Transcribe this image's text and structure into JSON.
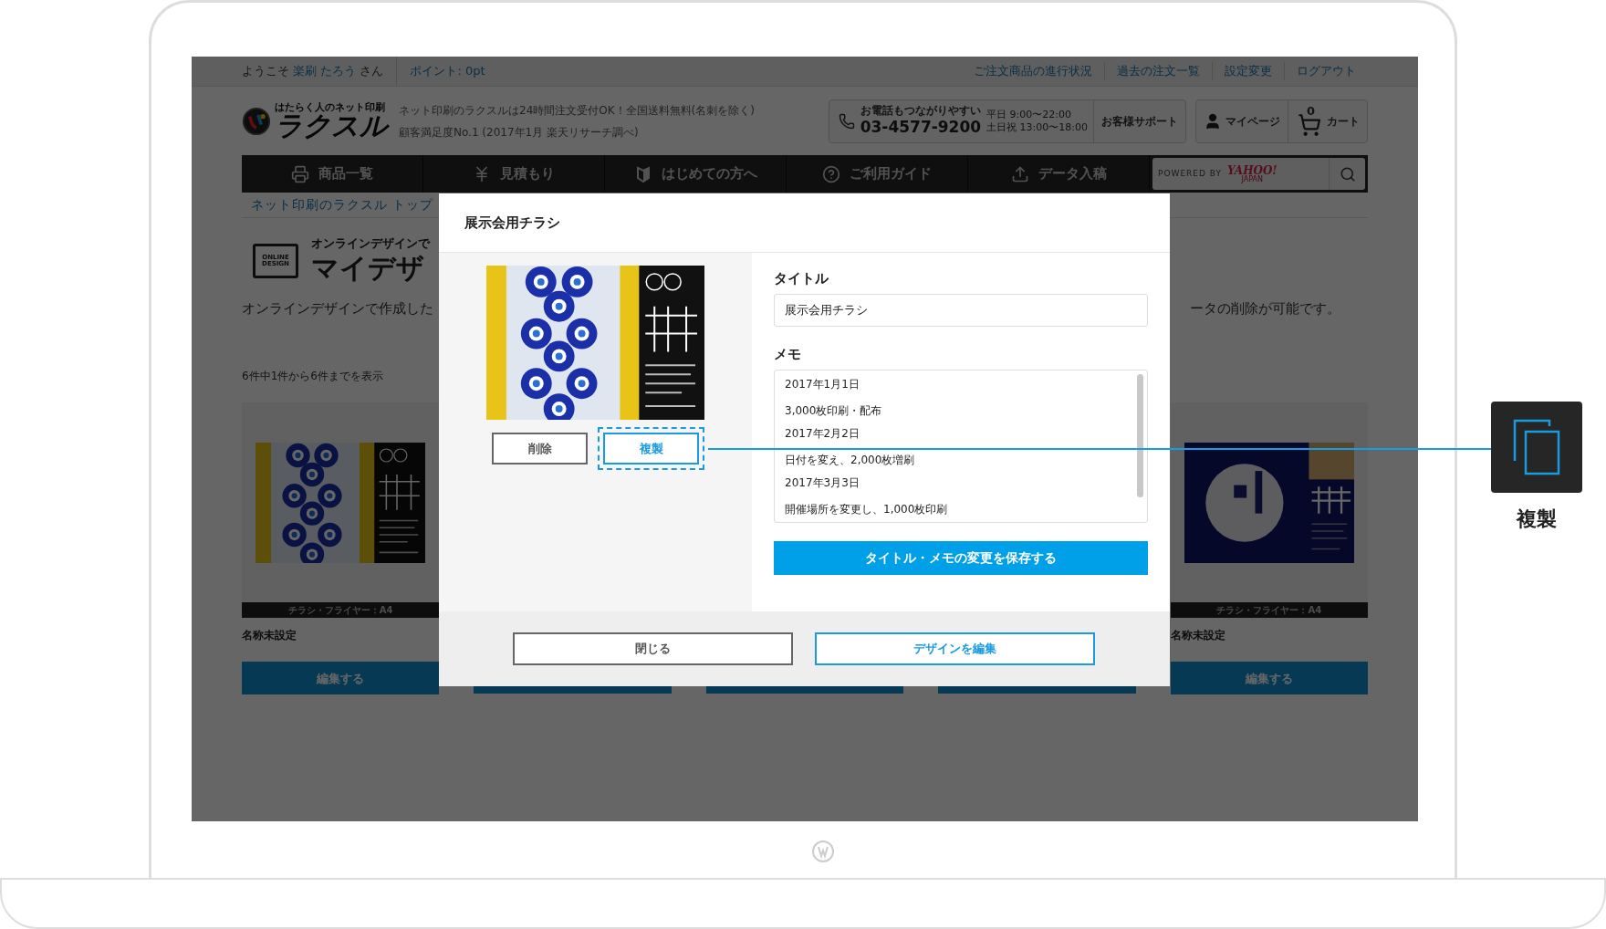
{
  "top_bar": {
    "greeting_prefix": "ようこそ",
    "user_name": "楽刷 たろう",
    "greeting_suffix": "さん",
    "points": "ポイント: 0pt",
    "links": [
      "ご注文商品の進行状況",
      "過去の注文一覧",
      "設定変更",
      "ログアウト"
    ]
  },
  "header": {
    "logo_tagline": "はたらく人のネット印刷",
    "logo_name": "ラクスル",
    "notices": [
      "ネット印刷のラクスルは24時間注文受付OK！全国送料無料(名刺を除く)",
      "顧客満足度No.1 (2017年1月 楽天リサーチ調べ)"
    ],
    "phone": {
      "caption": "お電話もつながりやすい",
      "number": "03-4577-9200",
      "hours": [
        "平日 9:00〜22:00",
        "土日祝 13:00〜18:00"
      ],
      "support": "お客様サポート"
    },
    "mypage": "マイページ",
    "cart": {
      "count": "0",
      "label": "カート"
    }
  },
  "nav": {
    "items": [
      {
        "kind": "printer",
        "label": "商品一覧"
      },
      {
        "kind": "yen",
        "label": "見積もり"
      },
      {
        "kind": "beginner",
        "label": "はじめての方へ"
      },
      {
        "kind": "help",
        "label": "ご利用ガイド"
      },
      {
        "kind": "upload",
        "label": "データ入稿"
      }
    ],
    "search": {
      "powered_by": "POWERED BY",
      "provider": "YAHOO!",
      "provider_sub": "JAPAN"
    }
  },
  "breadcrumb": "ネット印刷のラクスル トップ",
  "page_heading": {
    "badge_lines": [
      "ONLINE",
      "DESIGN"
    ],
    "subtitle": "オンラインデザインで",
    "title": "マイデザ"
  },
  "description": {
    "left": "オンラインデザインで作成した",
    "right": "ータの削除が可能です。"
  },
  "result_count": "6件中1件から6件までを表示",
  "cards": [
    {
      "kind": "full",
      "thumbnail": {
        "kind": "eye-beads"
      },
      "category": "チラシ・フライヤー：A4",
      "name": "名称未設定",
      "button": "編集する"
    },
    {
      "kind": "covered"
    },
    {
      "kind": "covered"
    },
    {
      "kind": "covered"
    },
    {
      "kind": "full",
      "thumbnail": {
        "kind": "night-circle"
      },
      "category": "チラシ・フライヤー：A4",
      "name": "名称未設定",
      "button": "編集する"
    }
  ],
  "modal": {
    "title": "展示会用チラシ",
    "thumbnail": {
      "kind": "eye-beads"
    },
    "delete": "削除",
    "duplicate": {
      "label": "複製",
      "highlighted": true
    },
    "title_label": "タイトル",
    "title_value": "展示会用チラシ",
    "memo_label": "メモ",
    "memo": [
      {
        "date": "2017年1月1日",
        "text": "3,000枚印刷・配布"
      },
      {
        "date": "2017年2月2日",
        "text": "日付を変え、2,000枚増刷"
      },
      {
        "date": "2017年3月3日",
        "text": "開催場所を変更し、1,000枚印刷"
      }
    ],
    "save": "タイトル・メモの変更を保存する",
    "close": "閉じる",
    "edit": "デザインを編集"
  },
  "callout": {
    "label": "複製"
  }
}
